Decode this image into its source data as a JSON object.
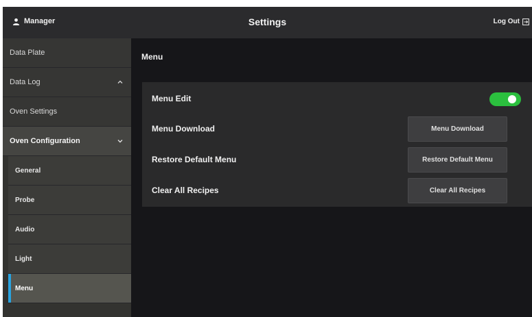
{
  "header": {
    "user": "Manager",
    "title": "Settings",
    "logout_label": "Log Out",
    "user_icon": "user-icon",
    "logout_icon": "logout-icon"
  },
  "sidebar": {
    "items": [
      {
        "label": "Data Plate"
      },
      {
        "label": "Data Log",
        "expanded": false
      },
      {
        "label": "Oven Settings"
      },
      {
        "label": "Oven Configuration",
        "expanded": true
      },
      {
        "label": "General"
      },
      {
        "label": "Probe"
      },
      {
        "label": "Audio"
      },
      {
        "label": "Light"
      },
      {
        "label": "Menu",
        "selected": true
      }
    ],
    "accent_color": "#29a3e0"
  },
  "main": {
    "title": "Menu",
    "rows": [
      {
        "label": "Menu Edit",
        "toggle_on": true
      },
      {
        "label": "Menu Download",
        "button_label": "Menu Download"
      },
      {
        "label": "Restore Default Menu",
        "button_label": "Restore Default Menu"
      },
      {
        "label": "Clear All Recipes",
        "button_label": "Clear All Recipes"
      }
    ],
    "toggle_color": "#2bbf3e"
  }
}
